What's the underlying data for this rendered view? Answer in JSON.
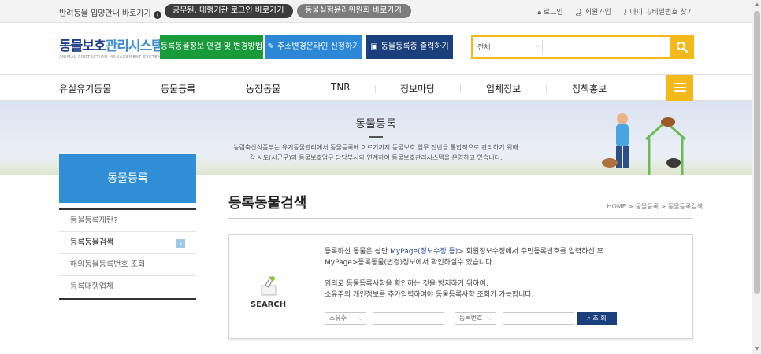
{
  "topbar": {
    "adopt_link": "반려동물 입양안내 바로가기",
    "official_login": "공무원, 대행기관 로그인 바로가기",
    "ethics_committee": "동물실험윤리위원회 바로가기",
    "login": "로그인",
    "join": "회원가입",
    "find_account": "아이디/비밀번호 찾기"
  },
  "header": {
    "logo_main": "동물보호",
    "logo_light": "관리시스템",
    "logo_en": "ANIMAL PROTECTION MANAGEMENT SYSTEM",
    "btn_info": "등록동물정보 연결 및 변경방법",
    "btn_address": "주소변경온라인 신청하기",
    "btn_print": "동물등록증 출력하기",
    "search_scope": "전체",
    "search_placeholder": ""
  },
  "nav": {
    "items": [
      "유실유기동물",
      "동물등록",
      "농장동물",
      "TNR",
      "정보마당",
      "업체정보",
      "정책홍보"
    ]
  },
  "banner": {
    "title": "동물등록",
    "desc_line1": "농림축산식품부는 유기동물관리에서 동물등록에 이르기까지 동물보호 업무 전반을 통합적으로 관리하기 위해",
    "desc_line2": "각 시도(시군구)의 동물보호업무 담당부서와 연계하여 동물보호관리시스템을 운영하고 있습니다."
  },
  "side": {
    "heading": "동물등록",
    "items": [
      "동물등록제란?",
      "등록동물검색",
      "해외동물등록번호 조회",
      "등록대행업체"
    ],
    "active_index": 1
  },
  "content": {
    "title": "등록동물검색",
    "breadcrumb": "HOME  >  동물등록  >  동물등록검색",
    "search_label": "SEARCH",
    "info1_pre": "등록하신 동물은 상단 ",
    "info1_hl": "MyPage(정보수정 등)",
    "info1_post": "> 회원정보수정에서 주민등록번호를 입력하신 후",
    "info2": "MyPage>등록동물(변경)정보에서 확인하실수 있습니다.",
    "info3": "임의로 동물등록사항을 확인하는 것을 방지하기 위하여,",
    "info4": "소유주의 개인정보를 추가입력하여야 동물등록사항 조회가 가능합니다.",
    "owner_select": "소유주",
    "reg_select": "등록번호",
    "query_button": "조 회"
  },
  "colors": {
    "brand_blue": "#2f8ed5",
    "green": "#1b9a3b",
    "navy": "#1b3f7a",
    "yellow": "#f5b81b"
  }
}
